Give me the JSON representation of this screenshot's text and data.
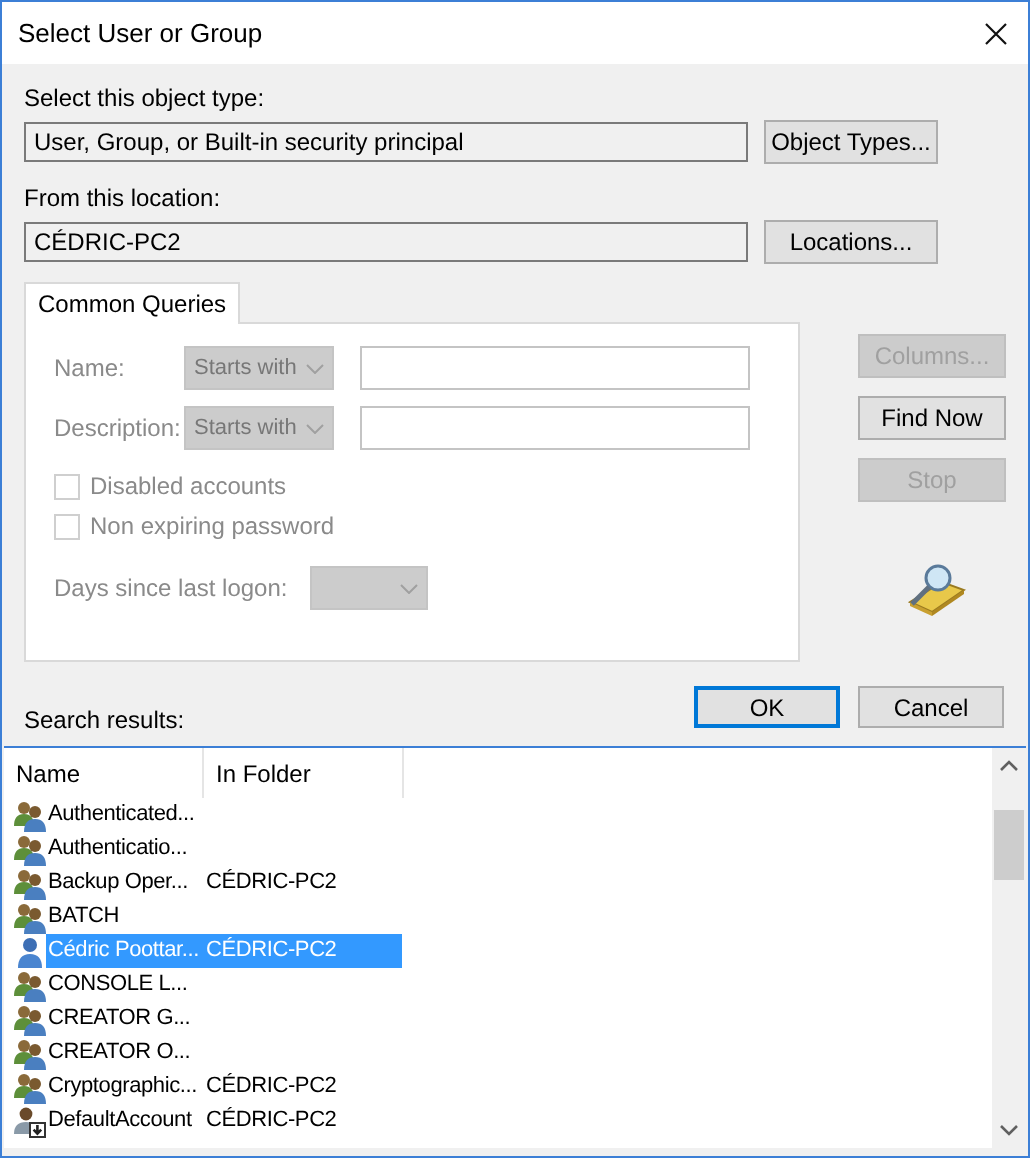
{
  "window": {
    "title": "Select User or Group"
  },
  "object_type": {
    "label": "Select this object type:",
    "value": "User, Group, or Built-in security principal",
    "button": "Object Types..."
  },
  "location": {
    "label": "From this location:",
    "value": "CÉDRIC-PC2",
    "button": "Locations..."
  },
  "tabs": [
    {
      "label": "Common Queries",
      "selected": true
    }
  ],
  "queries": [
    {
      "label": "Name:",
      "match": "Starts with",
      "disabled": true
    },
    {
      "label": "Description:",
      "match": "Starts with",
      "disabled": true
    }
  ],
  "checkboxes": [
    {
      "label": "Disabled accounts",
      "checked": false,
      "disabled": true
    },
    {
      "label": "Non expiring password",
      "checked": false,
      "disabled": true
    }
  ],
  "days_since_logon": {
    "label": "Days since last logon:",
    "disabled": true
  },
  "side_buttons": [
    {
      "label": "Columns...",
      "disabled": true
    },
    {
      "label": "Find Now",
      "disabled": false
    },
    {
      "label": "Stop",
      "disabled": true
    }
  ],
  "buttons": [
    {
      "label": "OK",
      "default": true
    },
    {
      "label": "Cancel",
      "default": false
    }
  ],
  "results": {
    "label": "Search results:",
    "columns": [
      "Name",
      "In Folder"
    ],
    "rows": [
      {
        "name": "Authenticated...",
        "kind": "group",
        "selected": false
      },
      {
        "name": "Authenticatio...",
        "kind": "group",
        "selected": false
      },
      {
        "name": "Backup Oper...",
        "folder": "CÉDRIC-PC2",
        "kind": "group",
        "selected": false
      },
      {
        "name": "BATCH",
        "kind": "group",
        "selected": false
      },
      {
        "name": "Cédric Poottar...",
        "folder": "CÉDRIC-PC2",
        "kind": "user",
        "selected": true
      },
      {
        "name": "CONSOLE L...",
        "kind": "group",
        "selected": false
      },
      {
        "name": "CREATOR G...",
        "kind": "group",
        "selected": false
      },
      {
        "name": "CREATOR O...",
        "kind": "group",
        "selected": false
      },
      {
        "name": "Cryptographic...",
        "folder": "CÉDRIC-PC2",
        "kind": "group",
        "selected": false
      },
      {
        "name": "DefaultAccount",
        "folder": "CÉDRIC-PC2",
        "kind": "account",
        "selected": false
      }
    ]
  }
}
